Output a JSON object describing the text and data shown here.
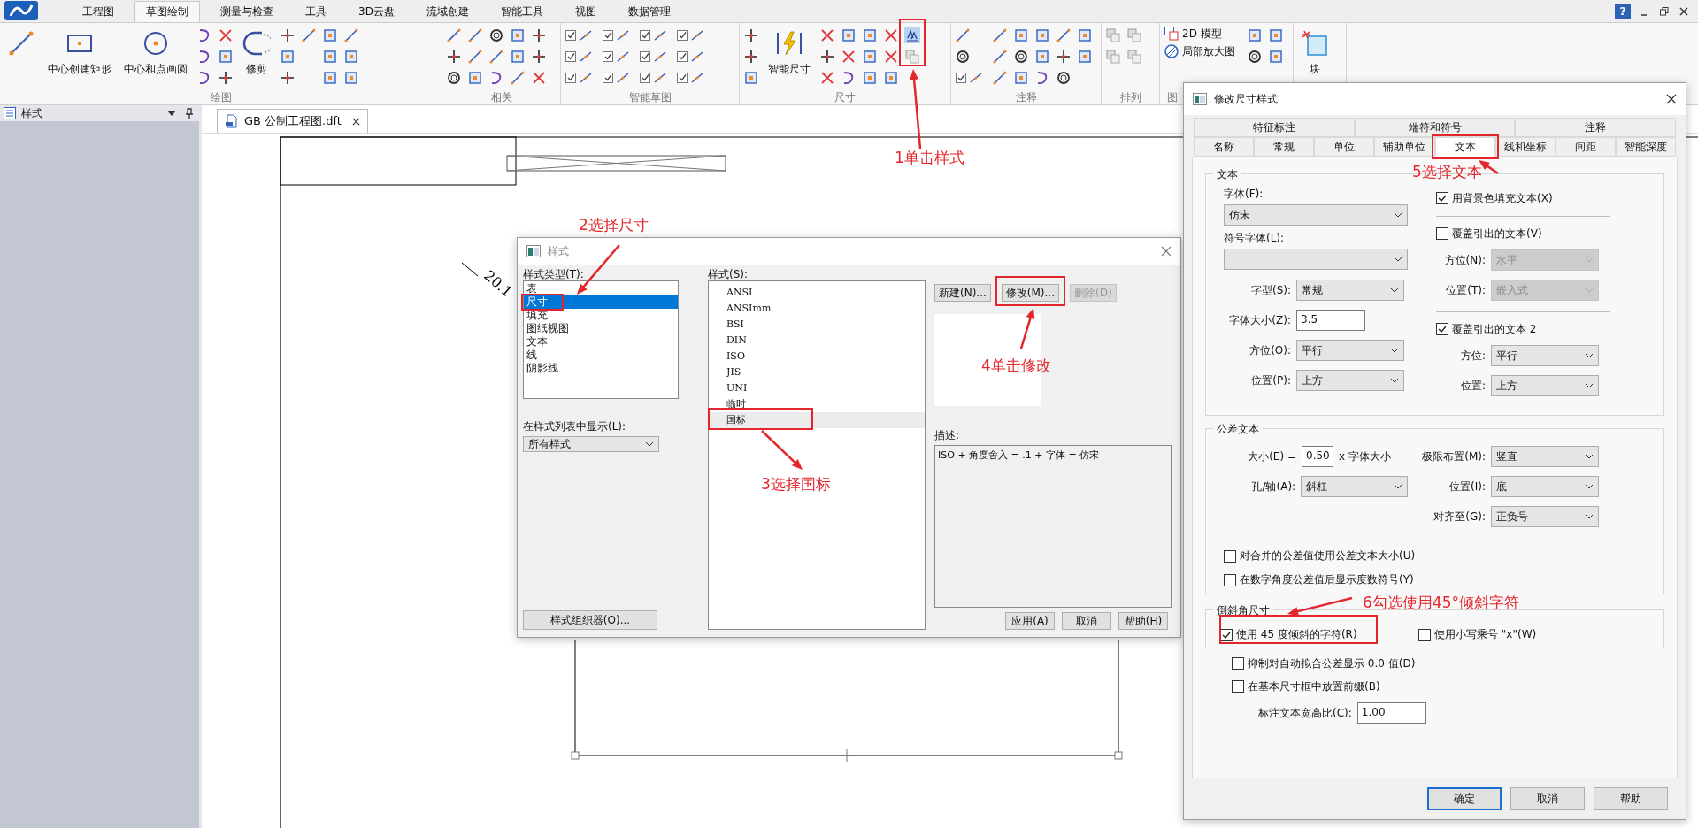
{
  "ribbon": {
    "tabs": [
      {
        "label": "工程图",
        "selected": false
      },
      {
        "label": "草图绘制",
        "selected": true
      },
      {
        "label": "测量与检查",
        "selected": false
      },
      {
        "label": "工具",
        "selected": false
      },
      {
        "label": "3D云盘",
        "selected": false
      },
      {
        "label": "流域创建",
        "selected": false
      },
      {
        "label": "智能工具",
        "selected": false
      },
      {
        "label": "视图",
        "selected": false
      },
      {
        "label": "数据管理",
        "selected": false
      }
    ],
    "help": "?",
    "groups": [
      {
        "label": "绘图",
        "buttons": [
          "中心创建矩形",
          "中心和点画圆",
          "修剪"
        ]
      },
      {
        "label": "相关"
      },
      {
        "label": "智能草图"
      },
      {
        "label": "尺寸",
        "buttons": [
          "智能尺寸"
        ]
      },
      {
        "label": "注释"
      },
      {
        "label": "排列"
      },
      {
        "label": "图",
        "buttons": [
          "2D 模型",
          "局部放大图"
        ]
      },
      {
        "buttons": [
          "块"
        ]
      }
    ]
  },
  "side_panel": {
    "title": "样式"
  },
  "document_tab": {
    "title": "GB 公制工程图.dft"
  },
  "drawing": {
    "dimension_text": "20.1"
  },
  "style_dialog": {
    "title": "样式",
    "type_label": "样式类型(T):",
    "types": [
      {
        "label": "表",
        "selected": false
      },
      {
        "label": "尺寸",
        "selected": true
      },
      {
        "label": "填充",
        "selected": false
      },
      {
        "label": "图纸视图",
        "selected": false
      },
      {
        "label": "文本",
        "selected": false
      },
      {
        "label": "线",
        "selected": false
      },
      {
        "label": "阴影线",
        "selected": false
      }
    ],
    "filter_label": "在样式列表中显示(L):",
    "filter": "所有样式",
    "styles_label": "样式(S):",
    "styles": [
      {
        "label": "ANSI",
        "selected": false
      },
      {
        "label": "ANSImm",
        "selected": false
      },
      {
        "label": "BSI",
        "selected": false
      },
      {
        "label": "DIN",
        "selected": false
      },
      {
        "label": "ISO",
        "selected": false
      },
      {
        "label": "JIS",
        "selected": false
      },
      {
        "label": "UNI",
        "selected": false
      },
      {
        "label": "临时",
        "selected": false
      },
      {
        "label": "国标",
        "selected": true
      }
    ],
    "actions": [
      {
        "label": "新建(N)...",
        "disabled": false
      },
      {
        "label": "修改(M)...",
        "disabled": false
      },
      {
        "label": "删除(D)",
        "disabled": true
      }
    ],
    "description_label": "描述:",
    "description": "ISO + 角度舍入 = .1 + 字体 = 仿宋",
    "organizer_button": "样式组织器(O)...",
    "buttons": [
      "应用(A)",
      "取消",
      "帮助(H)"
    ]
  },
  "dimension_dialog": {
    "title": "修改尺寸样式",
    "tab_rows": [
      [
        {
          "label": "特征标注",
          "selected": false
        },
        {
          "label": "端符和符号",
          "selected": false
        },
        {
          "label": "注释",
          "selected": false
        }
      ],
      [
        {
          "label": "名称",
          "selected": false
        },
        {
          "label": "常规",
          "selected": false
        },
        {
          "label": "单位",
          "selected": false
        },
        {
          "label": "辅助单位",
          "selected": false
        },
        {
          "label": "文本",
          "selected": true
        },
        {
          "label": "线和坐标",
          "selected": false
        },
        {
          "label": "间距",
          "selected": false
        },
        {
          "label": "智能深度",
          "selected": false
        }
      ]
    ],
    "groups": [
      {
        "title": "文本",
        "columns": [
          [
            {
              "kind": "stacked_select",
              "label": "字体(F):",
              "value": "仿宋",
              "disabled": false
            },
            {
              "kind": "stacked_select",
              "label": "符号字体(L):",
              "disabled": false
            },
            {
              "kind": "select",
              "label": "字型(S):",
              "value": "常规",
              "disabled": false
            },
            {
              "kind": "input",
              "label": "字体大小(Z):",
              "value": "3.5"
            },
            {
              "kind": "select",
              "label": "方位(O):",
              "value": "平行",
              "disabled": false
            },
            {
              "kind": "select",
              "label": "位置(P):",
              "value": "上方",
              "disabled": false
            }
          ],
          [
            {
              "kind": "checkbox",
              "label": "用背景色填充文本(X)",
              "checked": true
            },
            {
              "kind": "divider"
            },
            {
              "kind": "checkbox",
              "label": "覆盖引出的文本(V)",
              "checked": false
            },
            {
              "kind": "select",
              "label": "方位(N):",
              "value": "水平",
              "disabled": true
            },
            {
              "kind": "select",
              "label": "位置(T):",
              "value": "嵌入式",
              "disabled": true
            },
            {
              "kind": "divider"
            },
            {
              "kind": "checkbox",
              "label": "覆盖引出的文本 2",
              "checked": true
            },
            {
              "kind": "select",
              "label": "方位:",
              "value": "平行",
              "disabled": false
            },
            {
              "kind": "select",
              "label": "位置:",
              "value": "上方",
              "disabled": false
            }
          ]
        ]
      },
      {
        "title": "公差文本",
        "columns": [
          [
            {
              "kind": "input",
              "label": "大小(E) =",
              "value": "0.50",
              "suffix": "x 字体大小"
            },
            {
              "kind": "select",
              "label": "孔/轴(A):",
              "value": "斜杠",
              "disabled": false
            }
          ],
          [
            {
              "kind": "select",
              "label": "极限布置(M):",
              "value": "竖直",
              "disabled": false
            },
            {
              "kind": "select",
              "label": "位置(I):",
              "value": "底",
              "disabled": false
            },
            {
              "kind": "select",
              "label": "对齐至(G):",
              "value": "正负号",
              "disabled": false
            }
          ]
        ],
        "rows": [
          {
            "kind": "checkbox",
            "label": "对合并的公差值使用公差文本大小(U)",
            "checked": false
          },
          {
            "kind": "checkbox",
            "label": "在数字角度公差值后显示度数符号(Y)",
            "checked": false
          }
        ]
      },
      {
        "title": "倒斜角尺寸",
        "columns": [
          [
            {
              "kind": "checkbox",
              "label": "使用 45 度倾斜的字符(R)",
              "checked": true
            }
          ],
          [
            {
              "kind": "checkbox",
              "label": "使用小写乘号 \"x\"(W)",
              "checked": false
            }
          ]
        ]
      },
      {
        "rows": [
          {
            "kind": "checkbox",
            "label": "抑制对自动拟合公差显示 0.0 值(D)",
            "checked": false
          },
          {
            "kind": "checkbox",
            "label": "在基本尺寸框中放置前缀(B)",
            "checked": false
          },
          {
            "kind": "input",
            "label": "标注文本宽高比(C):",
            "value": "1.00"
          }
        ]
      }
    ],
    "buttons": [
      {
        "label": "确定",
        "default": true
      },
      {
        "label": "取消",
        "default": false
      },
      {
        "label": "帮助",
        "default": false
      }
    ]
  },
  "annotations": [
    {
      "text": "1单击样式"
    },
    {
      "text": "2选择尺寸"
    },
    {
      "text": "3选择国标"
    },
    {
      "text": "4单击修改"
    },
    {
      "text": "5选择文本"
    },
    {
      "text": "6勾选使用45°倾斜字符"
    }
  ]
}
